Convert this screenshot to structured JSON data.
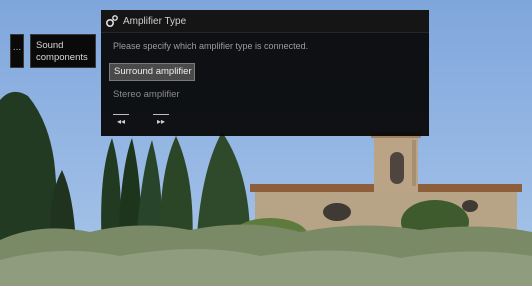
{
  "breadcrumb": {
    "prev_label": "...",
    "current_label": "Sound components"
  },
  "dialog": {
    "icon": "gear-icon",
    "title": "Amplifier Type",
    "description": "Please specify which amplifier type is connected.",
    "options": [
      {
        "label": "Surround amplifier",
        "selected": true
      },
      {
        "label": "Stereo amplifier",
        "selected": false
      }
    ],
    "nav": {
      "back_label": "◂◂",
      "forward_label": "▸▸"
    }
  }
}
